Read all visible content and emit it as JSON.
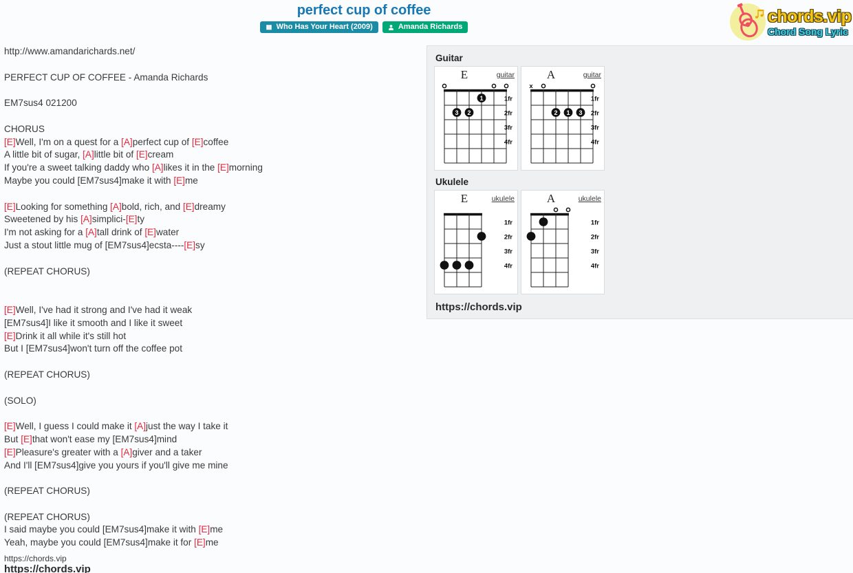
{
  "header": {
    "song_title": "perfect cup of coffee",
    "album_badge": {
      "icon": "book-icon",
      "label": "Who Has Your Heart (2009)",
      "color": "#1b8ca5"
    },
    "artist_badge": {
      "icon": "user-icon",
      "label": "Amanda Richards",
      "color": "#00a878"
    }
  },
  "logo": {
    "icon": "guitar-icon",
    "main_text": "chords.vip",
    "sub_text": "Chord Song Lyric",
    "main_color": "#f5c518",
    "sub_color": "#3fd0e8",
    "circle_color": "#f2ef9e"
  },
  "lyrics": {
    "source_url": "http://www.amandarichards.net/",
    "heading": "PERFECT CUP OF COFFEE - Amanda Richards",
    "chord_def": "EM7sus4 021200",
    "footer": "https://chords.vip",
    "chord_color": "#e8283c",
    "blocks": [
      {
        "type": "line",
        "segments": [
          {
            "t": "http://www.amandarichards.net/",
            "c": false
          }
        ]
      },
      {
        "type": "blank"
      },
      {
        "type": "line",
        "segments": [
          {
            "t": "PERFECT CUP OF COFFEE - Amanda Richards",
            "c": false
          }
        ]
      },
      {
        "type": "blank"
      },
      {
        "type": "line",
        "segments": [
          {
            "t": "EM7sus4 021200",
            "c": false
          }
        ]
      },
      {
        "type": "blank"
      },
      {
        "type": "line",
        "segments": [
          {
            "t": "CHORUS",
            "c": false
          }
        ]
      },
      {
        "type": "line",
        "segments": [
          {
            "t": "[E]",
            "c": true
          },
          {
            "t": "Well, I'm on a quest for a ",
            "c": false
          },
          {
            "t": "[A]",
            "c": true
          },
          {
            "t": "perfect cup of ",
            "c": false
          },
          {
            "t": "[E]",
            "c": true
          },
          {
            "t": "coffee",
            "c": false
          }
        ]
      },
      {
        "type": "line",
        "segments": [
          {
            "t": "A little bit of sugar, ",
            "c": false
          },
          {
            "t": "[A]",
            "c": true
          },
          {
            "t": "little bit of ",
            "c": false
          },
          {
            "t": "[E]",
            "c": true
          },
          {
            "t": "cream",
            "c": false
          }
        ]
      },
      {
        "type": "line",
        "segments": [
          {
            "t": "If you're a sweet talking daddy who ",
            "c": false
          },
          {
            "t": "[A]",
            "c": true
          },
          {
            "t": "likes it in the ",
            "c": false
          },
          {
            "t": "[E]",
            "c": true
          },
          {
            "t": "morning",
            "c": false
          }
        ]
      },
      {
        "type": "line",
        "segments": [
          {
            "t": "Maybe you could [EM7sus4]make it with ",
            "c": false
          },
          {
            "t": "[E]",
            "c": true
          },
          {
            "t": "me",
            "c": false
          }
        ]
      },
      {
        "type": "blank"
      },
      {
        "type": "line",
        "segments": [
          {
            "t": "[E]",
            "c": true
          },
          {
            "t": "Looking for something ",
            "c": false
          },
          {
            "t": "[A]",
            "c": true
          },
          {
            "t": "bold, rich, and ",
            "c": false
          },
          {
            "t": "[E]",
            "c": true
          },
          {
            "t": "dreamy",
            "c": false
          }
        ]
      },
      {
        "type": "line",
        "segments": [
          {
            "t": "Sweetened by his ",
            "c": false
          },
          {
            "t": "[A]",
            "c": true
          },
          {
            "t": "simplici-",
            "c": false
          },
          {
            "t": "[E]",
            "c": true
          },
          {
            "t": "ty",
            "c": false
          }
        ]
      },
      {
        "type": "line",
        "segments": [
          {
            "t": "I'm not asking for a ",
            "c": false
          },
          {
            "t": "[A]",
            "c": true
          },
          {
            "t": "tall drink of ",
            "c": false
          },
          {
            "t": "[E]",
            "c": true
          },
          {
            "t": "water",
            "c": false
          }
        ]
      },
      {
        "type": "line",
        "segments": [
          {
            "t": "Just a stout little mug of [EM7sus4]ecsta----",
            "c": false
          },
          {
            "t": "[E]",
            "c": true
          },
          {
            "t": "sy",
            "c": false
          }
        ]
      },
      {
        "type": "blank"
      },
      {
        "type": "line",
        "segments": [
          {
            "t": "(REPEAT CHORUS)",
            "c": false
          }
        ]
      },
      {
        "type": "blank"
      },
      {
        "type": "blank"
      },
      {
        "type": "line",
        "segments": [
          {
            "t": "[E]",
            "c": true
          },
          {
            "t": "Well, I've had it strong and I've had it weak",
            "c": false
          }
        ]
      },
      {
        "type": "line",
        "segments": [
          {
            "t": "[EM7sus4]I like it smooth and I like it sweet",
            "c": false
          }
        ]
      },
      {
        "type": "line",
        "segments": [
          {
            "t": "[E]",
            "c": true
          },
          {
            "t": "Drink it all while it's still hot",
            "c": false
          }
        ]
      },
      {
        "type": "line",
        "segments": [
          {
            "t": "But I [EM7sus4]won't turn off the coffee pot",
            "c": false
          }
        ]
      },
      {
        "type": "blank"
      },
      {
        "type": "line",
        "segments": [
          {
            "t": "(REPEAT CHORUS)",
            "c": false
          }
        ]
      },
      {
        "type": "blank"
      },
      {
        "type": "line",
        "segments": [
          {
            "t": "(SOLO)",
            "c": false
          }
        ]
      },
      {
        "type": "blank"
      },
      {
        "type": "line",
        "segments": [
          {
            "t": "[E]",
            "c": true
          },
          {
            "t": "Well, I guess I could make it ",
            "c": false
          },
          {
            "t": "[A]",
            "c": true
          },
          {
            "t": "just the way I take it",
            "c": false
          }
        ]
      },
      {
        "type": "line",
        "segments": [
          {
            "t": "But ",
            "c": false
          },
          {
            "t": "[E]",
            "c": true
          },
          {
            "t": "that won't ease my [EM7sus4]mind",
            "c": false
          }
        ]
      },
      {
        "type": "line",
        "segments": [
          {
            "t": "[E]",
            "c": true
          },
          {
            "t": "Pleasure's greater with a ",
            "c": false
          },
          {
            "t": "[A]",
            "c": true
          },
          {
            "t": "giver and a taker",
            "c": false
          }
        ]
      },
      {
        "type": "line",
        "segments": [
          {
            "t": "And I'll [EM7sus4]give you yours if you'll give me mine",
            "c": false
          }
        ]
      },
      {
        "type": "blank"
      },
      {
        "type": "line",
        "segments": [
          {
            "t": "(REPEAT CHORUS)",
            "c": false
          }
        ]
      },
      {
        "type": "blank"
      },
      {
        "type": "line",
        "segments": [
          {
            "t": "(REPEAT CHORUS)",
            "c": false
          }
        ]
      },
      {
        "type": "line",
        "segments": [
          {
            "t": "I said maybe you could [EM7sus4]make it with ",
            "c": false
          },
          {
            "t": "[E]",
            "c": true
          },
          {
            "t": "me",
            "c": false
          }
        ]
      },
      {
        "type": "line",
        "segments": [
          {
            "t": "Yeah, maybe you could [EM7sus4]make it for ",
            "c": false
          },
          {
            "t": "[E]",
            "c": true
          },
          {
            "t": "me",
            "c": false
          }
        ]
      }
    ]
  },
  "chord_panel": {
    "guitar_label": "Guitar",
    "ukulele_label": "Ukulele",
    "footer": "https://chords.vip",
    "guitar_link": "guitar",
    "ukulele_link": "ukulele",
    "fret_labels": [
      "1fr",
      "2fr",
      "3fr",
      "4fr"
    ],
    "diagrams": [
      {
        "instrument": "guitar",
        "name": "E",
        "strings": 6,
        "frets": 4,
        "open_strings": [
          1,
          5,
          6
        ],
        "muted_strings": [],
        "dots": [
          {
            "string": 4,
            "fret": 1,
            "finger": "1"
          },
          {
            "string": 3,
            "fret": 2,
            "finger": "2"
          },
          {
            "string": 2,
            "fret": 2,
            "finger": "3"
          }
        ]
      },
      {
        "instrument": "guitar",
        "name": "A",
        "strings": 6,
        "frets": 4,
        "open_strings": [
          2,
          6
        ],
        "muted_strings": [
          1
        ],
        "dots": [
          {
            "string": 3,
            "fret": 2,
            "finger": "2"
          },
          {
            "string": 4,
            "fret": 2,
            "finger": "1"
          },
          {
            "string": 5,
            "fret": 2,
            "finger": "3"
          }
        ]
      },
      {
        "instrument": "ukulele",
        "name": "E",
        "strings": 4,
        "frets": 4,
        "open_strings": [],
        "muted_strings": [],
        "dots": [
          {
            "string": 4,
            "fret": 2,
            "finger": ""
          },
          {
            "string": 1,
            "fret": 4,
            "finger": ""
          },
          {
            "string": 2,
            "fret": 4,
            "finger": ""
          },
          {
            "string": 3,
            "fret": 4,
            "finger": ""
          }
        ]
      },
      {
        "instrument": "ukulele",
        "name": "A",
        "strings": 4,
        "frets": 4,
        "open_strings": [
          3,
          4
        ],
        "muted_strings": [],
        "dots": [
          {
            "string": 2,
            "fret": 1,
            "finger": ""
          },
          {
            "string": 1,
            "fret": 2,
            "finger": ""
          }
        ]
      }
    ]
  },
  "page_footer": "https://chords.vip"
}
